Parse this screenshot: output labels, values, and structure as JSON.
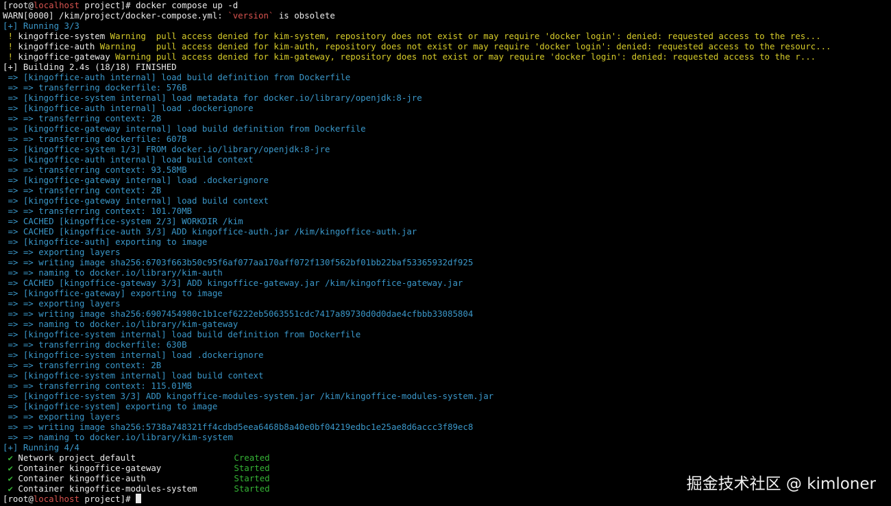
{
  "prompt": {
    "open_bracket": "[",
    "user": "root",
    "at": "@",
    "host": "localhost",
    "dir_part": " project]",
    "hash": "# ",
    "command": "docker compose up -d"
  },
  "warn": {
    "prefix": "WARN[0000] /kim/project/docker-compose.yml: ",
    "quoted": "`version`",
    "suffix": " is obsolete"
  },
  "running_3": "[+] Running 3/3",
  "pull_warnings": [
    {
      "bang": " ! ",
      "name": "kingoffice-system ",
      "text": "Warning  pull access denied for kim-system, repository does not exist or may require 'docker login': denied: requested access to the res..."
    },
    {
      "bang": " ! ",
      "name": "kingoffice-auth ",
      "text": "Warning    pull access denied for kim-auth, repository does not exist or may require 'docker login': denied: requested access to the resourc..."
    },
    {
      "bang": " ! ",
      "name": "kingoffice-gateway ",
      "text": "Warning pull access denied for kim-gateway, repository does not exist or may require 'docker login': denied: requested access to the r..."
    }
  ],
  "building": "[+] Building 2.4s (18/18) FINISHED",
  "build_steps": [
    " => [kingoffice-auth internal] load build definition from Dockerfile",
    " => => transferring dockerfile: 576B",
    " => [kingoffice-system internal] load metadata for docker.io/library/openjdk:8-jre",
    " => [kingoffice-auth internal] load .dockerignore",
    " => => transferring context: 2B",
    " => [kingoffice-gateway internal] load build definition from Dockerfile",
    " => => transferring dockerfile: 607B",
    " => [kingoffice-system 1/3] FROM docker.io/library/openjdk:8-jre",
    " => [kingoffice-auth internal] load build context",
    " => => transferring context: 93.58MB",
    " => [kingoffice-gateway internal] load .dockerignore",
    " => => transferring context: 2B",
    " => [kingoffice-gateway internal] load build context",
    " => => transferring context: 101.70MB",
    " => CACHED [kingoffice-system 2/3] WORKDIR /kim",
    " => CACHED [kingoffice-auth 3/3] ADD kingoffice-auth.jar /kim/kingoffice-auth.jar",
    " => [kingoffice-auth] exporting to image",
    " => => exporting layers",
    " => => writing image sha256:6703f663b50c95f6af077aa170aff072f130f562bf01bb22baf53365932df925",
    " => => naming to docker.io/library/kim-auth",
    " => CACHED [kingoffice-gateway 3/3] ADD kingoffice-gateway.jar /kim/kingoffice-gateway.jar",
    " => [kingoffice-gateway] exporting to image",
    " => => exporting layers",
    " => => writing image sha256:6907454980c1b1cef6222eb5063551cdc7417a89730d0d0dae4cfbbb33085804",
    " => => naming to docker.io/library/kim-gateway",
    " => [kingoffice-system internal] load build definition from Dockerfile",
    " => => transferring dockerfile: 630B",
    " => [kingoffice-system internal] load .dockerignore",
    " => => transferring context: 2B",
    " => [kingoffice-system internal] load build context",
    " => => transferring context: 115.01MB",
    " => [kingoffice-system 3/3] ADD kingoffice-modules-system.jar /kim/kingoffice-modules-system.jar",
    " => [kingoffice-system] exporting to image",
    " => => exporting layers",
    " => => writing image sha256:5738a748321ff4cdbd5eea6468b8a40e0bf04219edbc1e25ae8d6accc3f89ec8",
    " => => naming to docker.io/library/kim-system"
  ],
  "running_4": "[+] Running 4/4",
  "results": [
    {
      "check": " ✔ ",
      "name": "Network project_default",
      "status": "Created"
    },
    {
      "check": " ✔ ",
      "name": "Container kingoffice-gateway",
      "status": "Started"
    },
    {
      "check": " ✔ ",
      "name": "Container kingoffice-auth",
      "status": "Started"
    },
    {
      "check": " ✔ ",
      "name": "Container kingoffice-modules-system",
      "status": "Started"
    }
  ],
  "watermark": "掘金技术社区 @ kimloner",
  "colors": {
    "background": "#000000",
    "text": "#ececec",
    "host_red": "#d9534f",
    "build_blue": "#3a97c9",
    "warning_yellow": "#d7cc2a",
    "success_green": "#35b335"
  }
}
